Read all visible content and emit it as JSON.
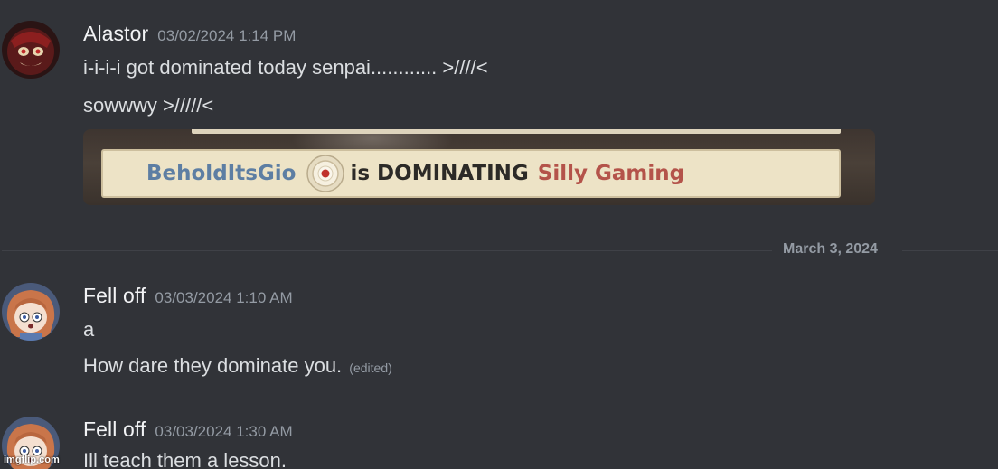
{
  "messages": [
    {
      "username": "Alastor",
      "timestamp": "03/02/2024 1:14 PM",
      "lines": [
        "i-i-i-i got dominated today senpai............ >////<",
        "sowwwy >/////<"
      ]
    },
    {
      "username": "Fell off",
      "timestamp": "03/03/2024 1:10 AM",
      "lines": [
        "a",
        "How dare they dominate you."
      ],
      "edited_label": "(edited)"
    },
    {
      "username": "Fell off",
      "timestamp": "03/03/2024 1:30 AM",
      "lines": [
        "Ill teach them a lesson."
      ]
    }
  ],
  "embed": {
    "player1": "BeholdItsGio",
    "action": "is DOMINATING",
    "player2": "Silly Gaming",
    "icon": "domination-target-icon"
  },
  "date_divider": "March 3, 2024",
  "watermark": "imgflip.com",
  "colors": {
    "background": "#313338",
    "username": "#f2f3f5",
    "message_text": "#dbdee1",
    "muted": "#949ba4",
    "killfeed_bg": "#ede3c6",
    "player1": "#5d7ea3",
    "player2": "#b4534a"
  }
}
